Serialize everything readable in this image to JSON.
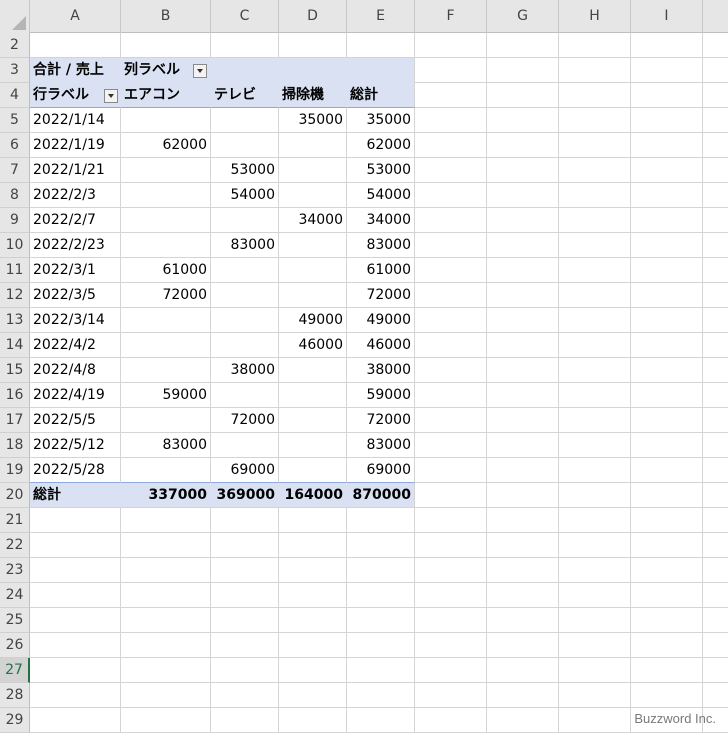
{
  "columns": [
    "A",
    "B",
    "C",
    "D",
    "E",
    "F",
    "G",
    "H",
    "I"
  ],
  "pivot": {
    "value_label": "合計 / 売上",
    "col_label": "列ラベル",
    "row_label": "行ラベル",
    "categories": [
      "エアコン",
      "テレビ",
      "掃除機",
      "総計"
    ],
    "rows": [
      {
        "row": "5",
        "date": "2022/1/14",
        "b": "",
        "c": "",
        "d": "35000",
        "e": "35000"
      },
      {
        "row": "6",
        "date": "2022/1/19",
        "b": "62000",
        "c": "",
        "d": "",
        "e": "62000"
      },
      {
        "row": "7",
        "date": "2022/1/21",
        "b": "",
        "c": "53000",
        "d": "",
        "e": "53000"
      },
      {
        "row": "8",
        "date": "2022/2/3",
        "b": "",
        "c": "54000",
        "d": "",
        "e": "54000"
      },
      {
        "row": "9",
        "date": "2022/2/7",
        "b": "",
        "c": "",
        "d": "34000",
        "e": "34000"
      },
      {
        "row": "10",
        "date": "2022/2/23",
        "b": "",
        "c": "83000",
        "d": "",
        "e": "83000"
      },
      {
        "row": "11",
        "date": "2022/3/1",
        "b": "61000",
        "c": "",
        "d": "",
        "e": "61000"
      },
      {
        "row": "12",
        "date": "2022/3/5",
        "b": "72000",
        "c": "",
        "d": "",
        "e": "72000"
      },
      {
        "row": "13",
        "date": "2022/3/14",
        "b": "",
        "c": "",
        "d": "49000",
        "e": "49000"
      },
      {
        "row": "14",
        "date": "2022/4/2",
        "b": "",
        "c": "",
        "d": "46000",
        "e": "46000"
      },
      {
        "row": "15",
        "date": "2022/4/8",
        "b": "",
        "c": "38000",
        "d": "",
        "e": "38000"
      },
      {
        "row": "16",
        "date": "2022/4/19",
        "b": "59000",
        "c": "",
        "d": "",
        "e": "59000"
      },
      {
        "row": "17",
        "date": "2022/5/5",
        "b": "",
        "c": "72000",
        "d": "",
        "e": "72000"
      },
      {
        "row": "18",
        "date": "2022/5/12",
        "b": "83000",
        "c": "",
        "d": "",
        "e": "83000"
      },
      {
        "row": "19",
        "date": "2022/5/28",
        "b": "",
        "c": "69000",
        "d": "",
        "e": "69000"
      }
    ],
    "total": {
      "label": "総計",
      "b": "337000",
      "c": "369000",
      "d": "164000",
      "e": "870000"
    }
  },
  "row_numbers": {
    "r2": "2",
    "r3": "3",
    "r4": "4",
    "r20": "20",
    "empty": [
      "21",
      "22",
      "23",
      "24",
      "25",
      "26",
      "27",
      "28",
      "29"
    ]
  },
  "active_row": "27",
  "watermark": "Buzzword Inc."
}
